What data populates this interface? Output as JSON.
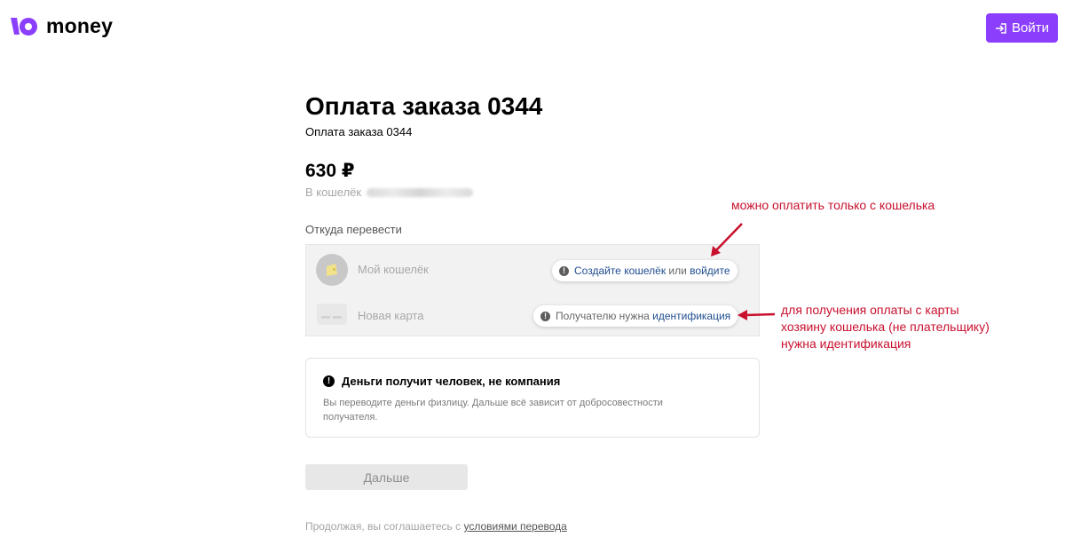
{
  "header": {
    "logo_text": "money",
    "login_label": "Войти",
    "brand_color": "#8b3ffd"
  },
  "payment": {
    "title": "Оплата заказа 0344",
    "subtitle": "Оплата заказа 0344",
    "amount": "630 ₽",
    "wallet_prefix": "В кошелёк"
  },
  "sources": {
    "label": "Откуда перевести",
    "items": [
      {
        "label": "Мой кошелёк",
        "icon": "wallet-icon",
        "hint": {
          "link1": "Создайте кошелёк",
          "middle": " или ",
          "link2": "войдите"
        }
      },
      {
        "label": "Новая карта",
        "icon": "card-icon",
        "hint": {
          "text": "Получателю нужна ",
          "link": "идентификация"
        }
      }
    ]
  },
  "notice": {
    "title": "Деньги получит человек, не компания",
    "text": "Вы переводите деньги физлицу. Дальше всё зависит от добросовестности получателя."
  },
  "actions": {
    "next_label": "Дальше",
    "terms_prefix": "Продолжая, вы соглашаетесь с ",
    "terms_link": "условиями перевода"
  },
  "annotations": {
    "note1": "можно оплатить только с кошелька",
    "note2_line1": "для получения оплаты с карты",
    "note2_line2": "хозяину кошелька (не плательщику)",
    "note2_line3": "нужна идентификация",
    "color": "#c8102e"
  }
}
